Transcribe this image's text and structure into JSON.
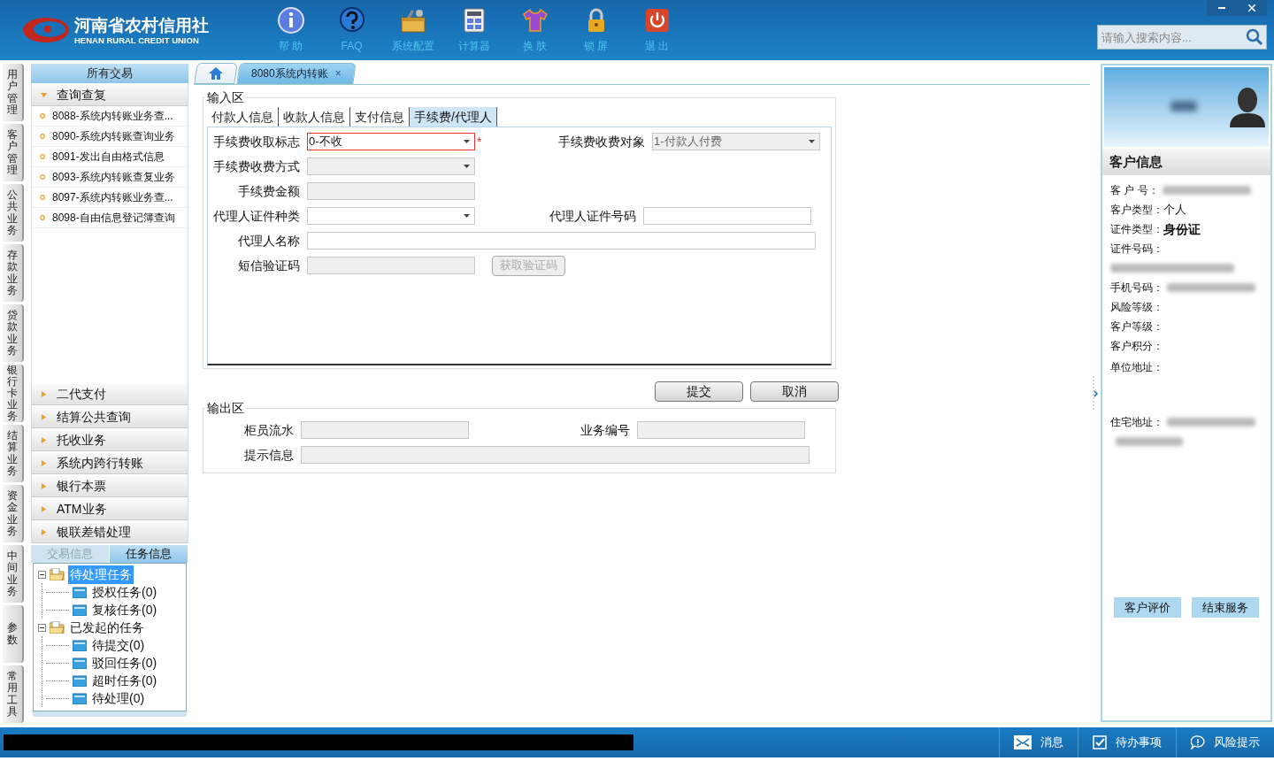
{
  "header": {
    "logo_cn": "河南省农村信用社",
    "logo_en": "HENAN RURAL CREDIT UNION",
    "toolbar": [
      {
        "kind": "help",
        "label": "帮 助"
      },
      {
        "kind": "faq",
        "label": "FAQ"
      },
      {
        "kind": "config",
        "label": "系统配置"
      },
      {
        "kind": "calc",
        "label": "计算器"
      },
      {
        "kind": "skin",
        "label": "换 肤"
      },
      {
        "kind": "lock",
        "label": "锁 屏"
      },
      {
        "kind": "exit",
        "label": "退 出"
      }
    ],
    "search": {
      "placeholder": "请输入搜索内容..."
    }
  },
  "side_tabs": [
    {
      "label": "用户管理",
      "selected": false
    },
    {
      "label": "客户管理",
      "selected": false
    },
    {
      "label": "公共业务",
      "selected": false
    },
    {
      "label": "存款业务",
      "selected": false
    },
    {
      "label": "贷款业务",
      "selected": false
    },
    {
      "label": "银行卡业务",
      "selected": false
    },
    {
      "label": "结算业务",
      "selected": false
    },
    {
      "label": "资金业务",
      "selected": false
    },
    {
      "label": "中间业务",
      "selected": false
    },
    {
      "label": "参数",
      "selected": false
    },
    {
      "label": "常用工具",
      "selected": false
    }
  ],
  "nav": {
    "title": "所有交易",
    "groups": [
      {
        "label": "查询查复",
        "expanded": true,
        "items": [
          "8088-系统内转账业务查...",
          "8090-系统内转账查询业务",
          "8091-发出自由格式信息",
          "8093-系统内转账查复业务",
          "8097-系统内转账业务查...",
          "8098-自由信息登记簿查询"
        ]
      },
      {
        "label": "二代支付",
        "expanded": false
      },
      {
        "label": "结算公共查询",
        "expanded": false
      },
      {
        "label": "托收业务",
        "expanded": false
      },
      {
        "label": "系统内跨行转账",
        "expanded": false
      },
      {
        "label": "银行本票",
        "expanded": false
      },
      {
        "label": "ATM业务",
        "expanded": false
      },
      {
        "label": "银联差错处理",
        "expanded": false
      }
    ]
  },
  "task_panel": {
    "tabs": [
      {
        "label": "交易信息",
        "selected": false
      },
      {
        "label": "任务信息",
        "selected": true
      }
    ],
    "tree": [
      {
        "label": "待处理任务",
        "selected": true,
        "expanded": true,
        "children": [
          {
            "label": "授权任务(0)",
            "selected": false
          },
          {
            "label": "复核任务(0)",
            "selected": false
          }
        ]
      },
      {
        "label": "已发起的任务",
        "selected": false,
        "expanded": true,
        "children": [
          {
            "label": "待提交(0)",
            "selected": false
          },
          {
            "label": "驳回任务(0)",
            "selected": false
          },
          {
            "label": "超时任务(0)",
            "selected": false
          },
          {
            "label": "待处理(0)",
            "selected": false
          }
        ]
      }
    ]
  },
  "doc_tabs": [
    {
      "kind": "home",
      "selected": false
    },
    {
      "kind": "page",
      "label": "8080系统内转账",
      "close": "×",
      "selected": true
    }
  ],
  "input_area": {
    "title": "输入区",
    "tabs": [
      {
        "label": "付款人信息",
        "selected": false
      },
      {
        "label": "收款人信息",
        "selected": false
      },
      {
        "label": "支付信息",
        "selected": false
      },
      {
        "label": "手续费/代理人",
        "selected": true
      }
    ],
    "rows": [
      [
        {
          "label": "手续费收取标志",
          "kind": "select",
          "value": "0-不收",
          "disabled": false,
          "invalid": true,
          "required": "*"
        },
        {
          "label": "手续费收费对象",
          "kind": "select",
          "value": "1-付款人付费",
          "disabled": true,
          "invalid": false
        }
      ],
      [
        {
          "label": "手续费收费方式",
          "kind": "select",
          "disabled": true,
          "invalid": false
        }
      ],
      [
        {
          "label": "手续费金额",
          "kind": "input",
          "disabled": true,
          "invalid": false
        }
      ],
      [
        {
          "label": "代理人证件种类",
          "kind": "select",
          "disabled": false,
          "invalid": false
        },
        {
          "label": "代理人证件号码",
          "kind": "input",
          "disabled": false,
          "invalid": false
        }
      ],
      [
        {
          "label": "代理人名称",
          "kind": "wide",
          "disabled": false,
          "invalid": false
        }
      ],
      [
        {
          "label": "短信验证码",
          "kind": "input",
          "disabled": true,
          "invalid": false,
          "button": {
            "label": "获取验证码",
            "disabled": true
          }
        }
      ]
    ]
  },
  "actions": [
    "提交",
    "取消"
  ],
  "output_area": {
    "title": "输出区",
    "rows": [
      [
        {
          "label": "柜员流水",
          "kind": "input"
        },
        {
          "label": "业务编号",
          "kind": "input"
        }
      ],
      [
        {
          "label": "提示信息",
          "kind": "wide"
        }
      ]
    ]
  },
  "customer": {
    "title": "客户信息",
    "fields": [
      {
        "label": "客 户 号：",
        "kind": "blurred"
      },
      {
        "label": "客户类型：",
        "kind": "text",
        "value": "个人"
      },
      {
        "label": "证件类型：",
        "kind": "bold",
        "value": "身份证"
      },
      {
        "label": "证件号码：",
        "kind": "blurred_below"
      },
      {
        "label": "手机号码：",
        "kind": "blurred"
      },
      {
        "label": "风险等级：",
        "kind": "empty"
      },
      {
        "label": "客户等级：",
        "kind": "empty"
      },
      {
        "label": "客户积分：",
        "kind": "empty"
      },
      {
        "label": "单位地址：",
        "kind": "tall"
      },
      {
        "label": "住宅地址：",
        "kind": "blurred_two"
      }
    ],
    "buttons": [
      "客户评价",
      "结束服务"
    ]
  },
  "status_bar": {
    "items": [
      {
        "kind": "mail",
        "label": "消息"
      },
      {
        "kind": "todo",
        "label": "待办事项"
      },
      {
        "kind": "risk",
        "label": "风险提示"
      }
    ]
  }
}
